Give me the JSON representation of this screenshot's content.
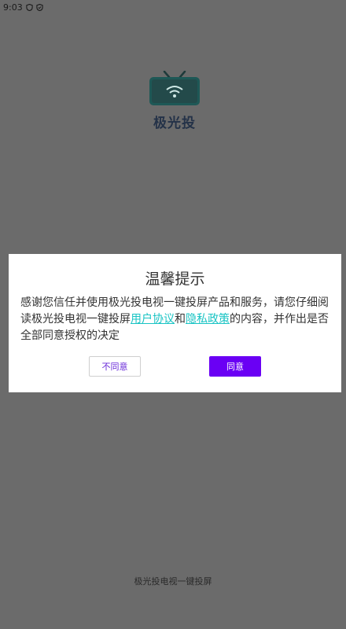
{
  "status_bar": {
    "time": "9:03",
    "icons": [
      "shield-icon",
      "shield-check-icon"
    ]
  },
  "app": {
    "name": "极光投",
    "footer": "极光投电视一键投屏"
  },
  "dialog": {
    "title": "温馨提示",
    "body_before": "感谢您信任并使用极光投电视一键投屏产品和服务，请您仔细阅读极光投电视一键投屏",
    "link_user_agreement": "用户协议",
    "body_and": "和",
    "link_privacy_policy": "隐私政策",
    "body_after": "的内容，并作出是否全部同意授权的决定",
    "disagree_label": "不同意",
    "agree_label": "同意"
  },
  "colors": {
    "overlay": "#6b6b6b",
    "link": "#19c4c4",
    "primary": "#6a00f4"
  }
}
